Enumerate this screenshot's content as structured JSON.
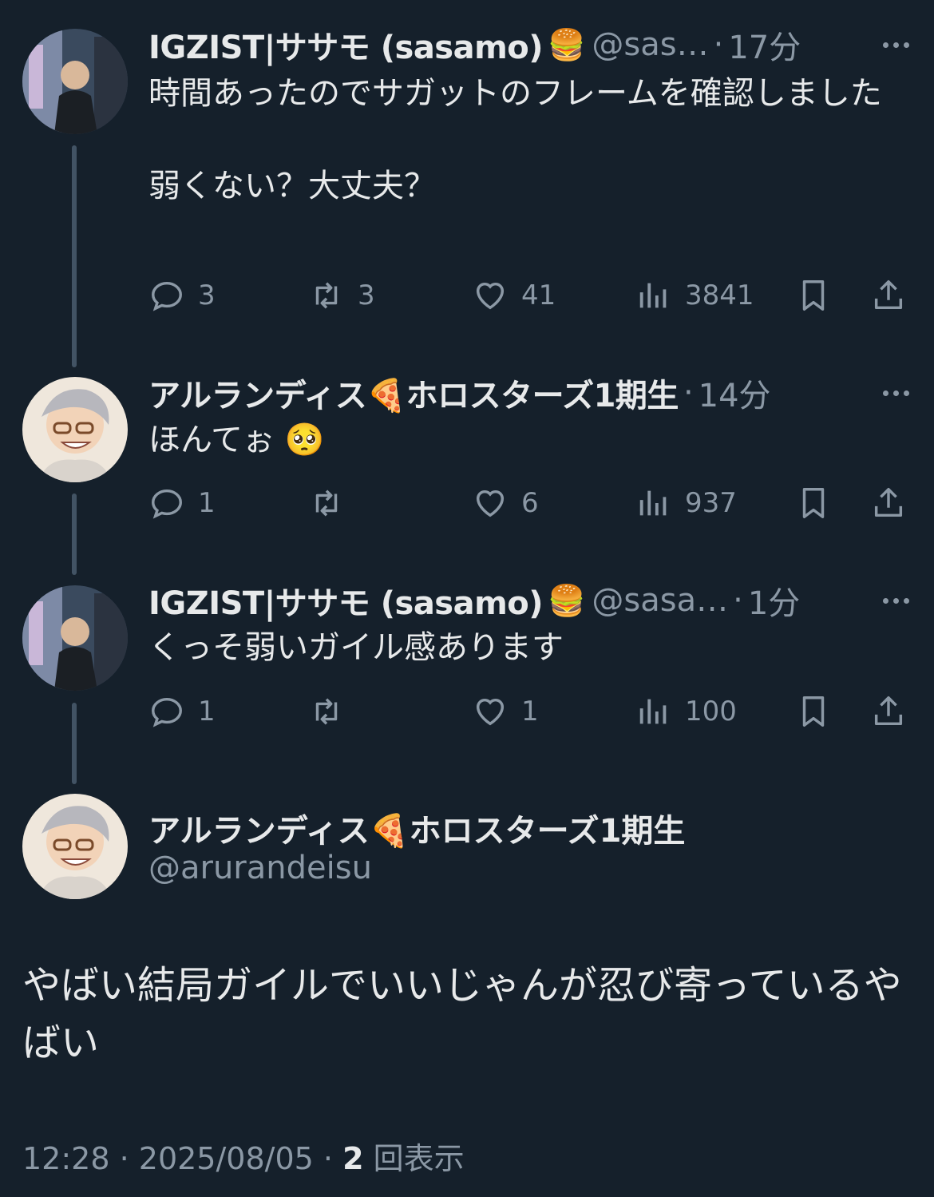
{
  "colors": {
    "background": "#15202b",
    "text": "#e7e9ea",
    "muted": "#8b98a5",
    "thread_line": "#425364"
  },
  "replies": [
    {
      "name": "IGZIST|ササモ (sasamo)",
      "emoji": "🍔",
      "handle": "@sas…",
      "time": "17分",
      "text": "時間あったのでサガットのフレームを確認しました\n\n弱くない？大丈夫？",
      "reply_count": "3",
      "retweet_count": "3",
      "like_count": "41",
      "view_count": "3841"
    },
    {
      "name": "アルランディス🍕ホロスターズ1期生",
      "emoji": "",
      "handle": "",
      "time": "14分",
      "text": "ほんてぉ 🥺",
      "reply_count": "1",
      "retweet_count": "",
      "like_count": "6",
      "view_count": "937"
    },
    {
      "name": "IGZIST|ササモ (sasamo)",
      "emoji": "🍔",
      "handle": "@sasa…",
      "time": "1分",
      "text": "くっそ弱いガイル感あります",
      "reply_count": "1",
      "retweet_count": "",
      "like_count": "1",
      "view_count": "100"
    }
  ],
  "main": {
    "name": "アルランディス🍕ホロスターズ1期生",
    "handle": "@arurandeisu",
    "text": "やばい結局ガイルでいいじゃんが忍び寄っているやばい",
    "time": "12:28",
    "date": "2025/08/05",
    "view_count": "2",
    "view_label": "回表示"
  },
  "icons": [
    "reply-icon",
    "retweet-icon",
    "like-icon",
    "views-icon",
    "bookmark-icon",
    "share-icon",
    "more-icon"
  ]
}
